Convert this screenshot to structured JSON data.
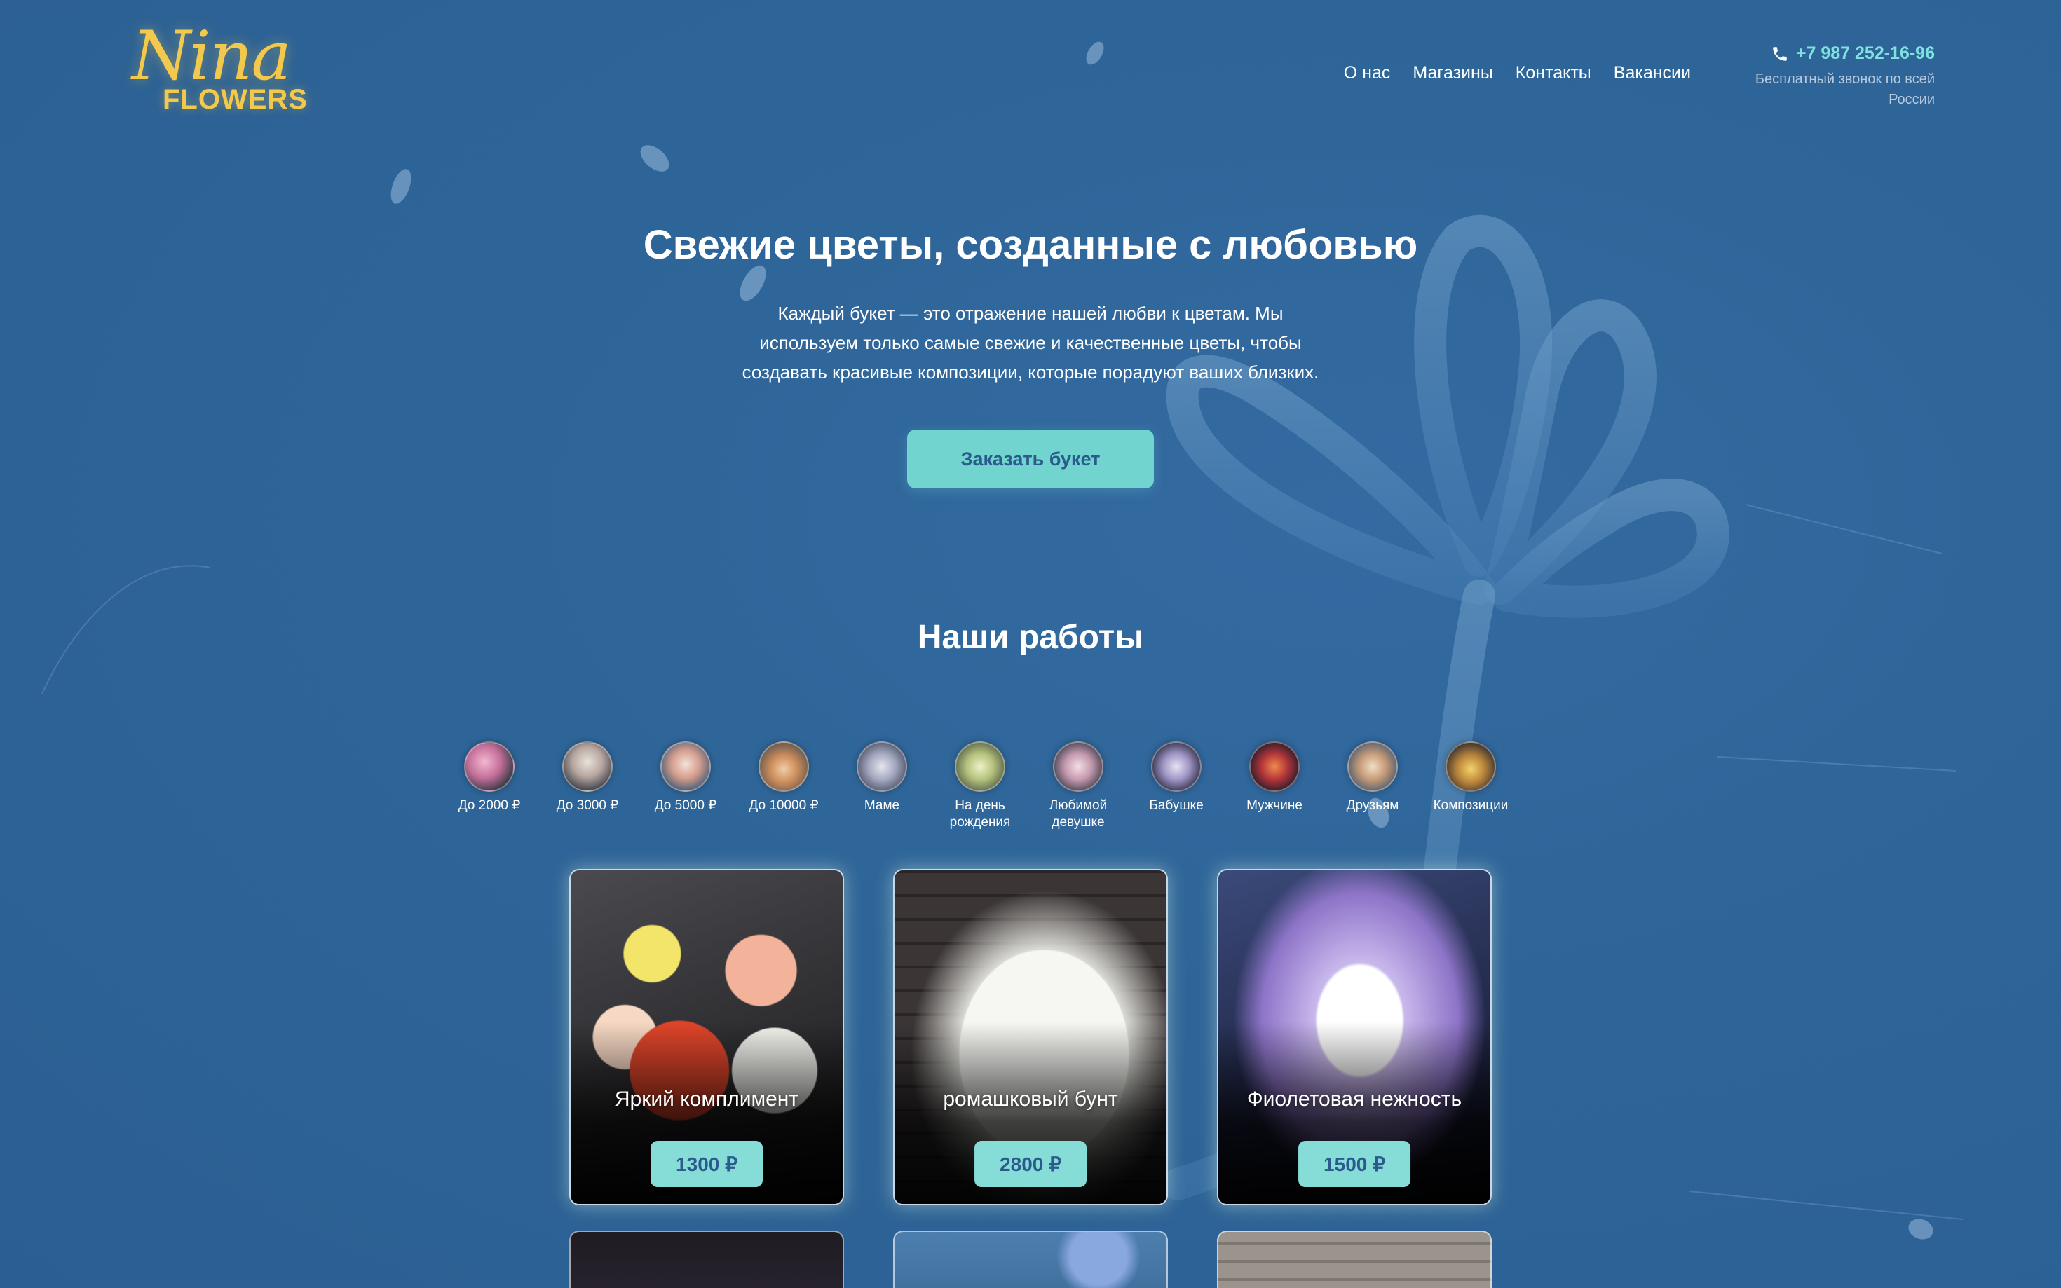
{
  "brand": {
    "logo_script": "Nina",
    "logo_word": "FLOWERS"
  },
  "nav": {
    "items": [
      {
        "label": "О нас"
      },
      {
        "label": "Магазины"
      },
      {
        "label": "Контакты"
      },
      {
        "label": "Вакансии"
      }
    ]
  },
  "contact": {
    "phone": "+7 987 252-16-96",
    "note_line1": "Бесплатный звонок по всей",
    "note_line2": "России",
    "phone_icon": "phone-icon"
  },
  "hero": {
    "title": "Свежие цветы, созданные с любовью",
    "text_lines": [
      "Каждый букет — это отражение нашей любви к цветам. Мы",
      "используем только самые свежие и качественные цветы, чтобы",
      "создавать красивые композиции, которые порадуют ваших близких."
    ],
    "cta_label": "Заказать букет"
  },
  "works": {
    "title": "Наши работы",
    "categories": [
      {
        "line1": "До 2000 ₽",
        "line2": ""
      },
      {
        "line1": "До 3000 ₽",
        "line2": ""
      },
      {
        "line1": "До 5000 ₽",
        "line2": ""
      },
      {
        "line1": "До 10000 ₽",
        "line2": ""
      },
      {
        "line1": "Маме",
        "line2": ""
      },
      {
        "line1": "На день",
        "line2": "рождения"
      },
      {
        "line1": "Любимой",
        "line2": "девушке"
      },
      {
        "line1": "Бабушке",
        "line2": ""
      },
      {
        "line1": "Мужчине",
        "line2": ""
      },
      {
        "line1": "Друзьям",
        "line2": ""
      },
      {
        "line1": "Композиции",
        "line2": ""
      }
    ],
    "cards": [
      {
        "title": "Яркий комплимент",
        "price": "1300 ₽"
      },
      {
        "title": "ромашковый бунт",
        "price": "2800 ₽"
      },
      {
        "title": "Фиолетовая нежность",
        "price": "1500 ₽"
      }
    ]
  },
  "colors": {
    "background": "#2e6598",
    "accent_teal": "#72d4cf",
    "logo_gold": "#f2c94c",
    "phone_teal": "#7ee3df"
  }
}
